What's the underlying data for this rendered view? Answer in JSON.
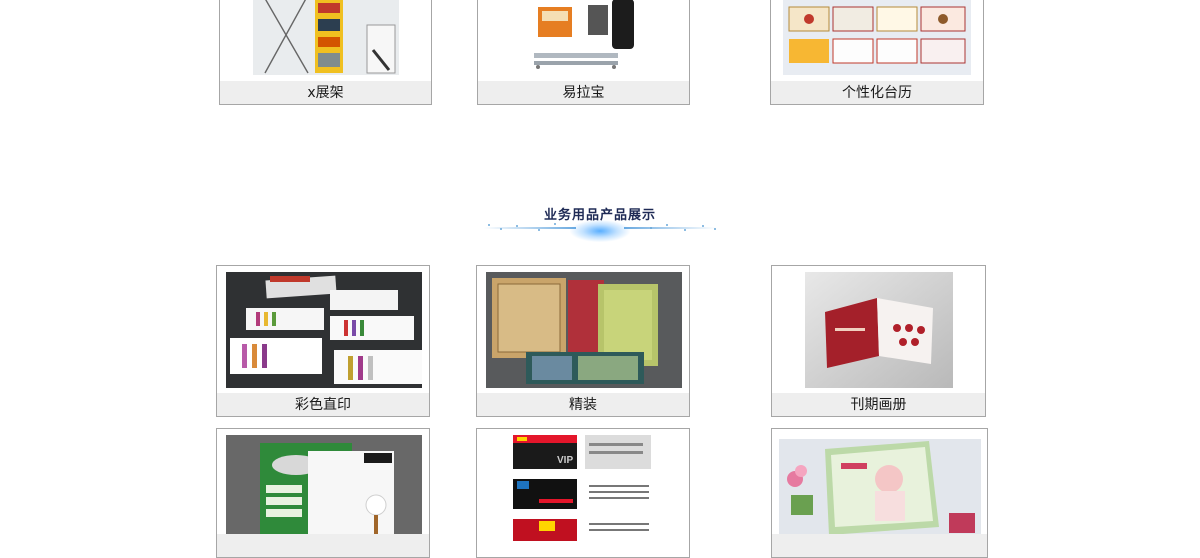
{
  "row_top": [
    {
      "label": "x展架"
    },
    {
      "label": "易拉宝"
    },
    {
      "label": "个性化台历"
    }
  ],
  "section": {
    "title": "业务用品产品展示"
  },
  "row_middle": [
    {
      "label": "彩色直印"
    },
    {
      "label": "精装"
    },
    {
      "label": "刊期画册"
    }
  ],
  "row_bottom": [
    {
      "label": ""
    },
    {
      "label": "VIP"
    },
    {
      "label": ""
    }
  ]
}
